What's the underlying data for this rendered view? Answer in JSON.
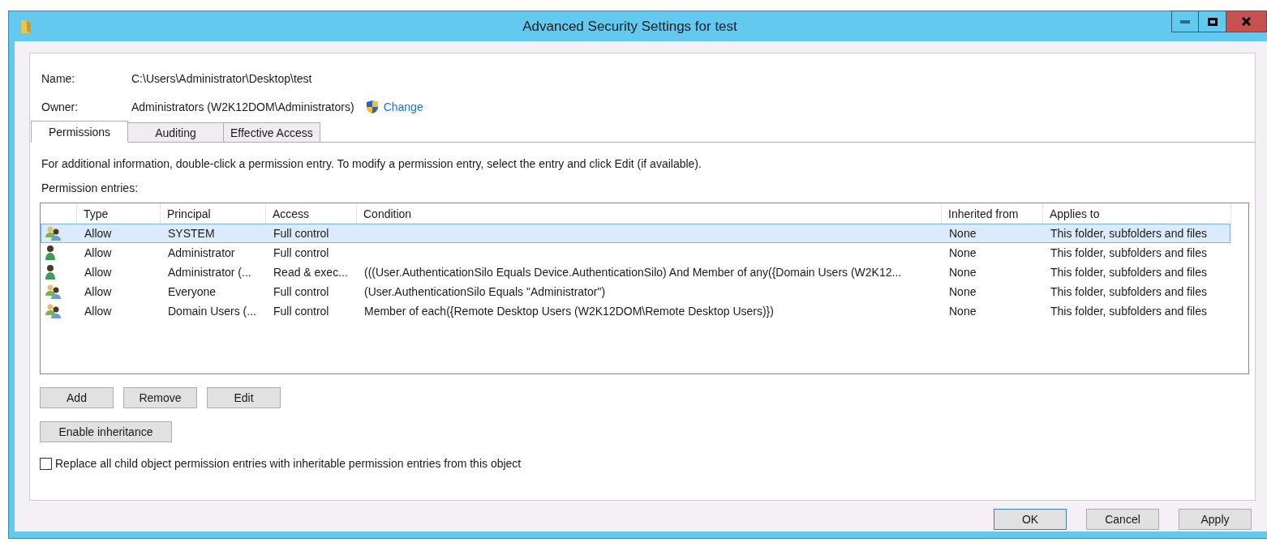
{
  "window": {
    "title": "Advanced Security Settings for test"
  },
  "name": {
    "label": "Name:",
    "value": "C:\\Users\\Administrator\\Desktop\\test"
  },
  "owner": {
    "label": "Owner:",
    "value": "Administrators (W2K12DOM\\Administrators)",
    "link": "Change"
  },
  "tabs": [
    {
      "label": "Permissions",
      "selected": true
    },
    {
      "label": "Auditing",
      "selected": false
    },
    {
      "label": "Effective Access",
      "selected": false
    }
  ],
  "info": "For additional information, double-click a permission entry. To modify a permission entry, select the entry and click Edit (if available).",
  "entries_label": "Permission entries:",
  "table": {
    "columns": [
      "Type",
      "Principal",
      "Access",
      "Condition",
      "Inherited from",
      "Applies to"
    ],
    "rows": [
      {
        "kind": "group",
        "selected": true,
        "cells": [
          "Allow",
          "SYSTEM",
          "Full control",
          "",
          "None",
          "This folder, subfolders and files"
        ]
      },
      {
        "kind": "user",
        "selected": false,
        "cells": [
          "Allow",
          "Administrator",
          "Full control",
          "",
          "None",
          "This folder, subfolders and files"
        ]
      },
      {
        "kind": "user",
        "selected": false,
        "cells": [
          "Allow",
          "Administrator (...",
          "Read & exec...",
          "(((User.AuthenticationSilo Equals Device.AuthenticationSilo) And Member of any({Domain Users (W2K12...",
          "None",
          "This folder, subfolders and files"
        ]
      },
      {
        "kind": "group",
        "selected": false,
        "cells": [
          "Allow",
          "Everyone",
          "Full control",
          "(User.AuthenticationSilo Equals \"Administrator\")",
          "None",
          "This folder, subfolders and files"
        ]
      },
      {
        "kind": "group",
        "selected": false,
        "cells": [
          "Allow",
          "Domain Users (...",
          "Full control",
          "Member of each({Remote Desktop Users (W2K12DOM\\Remote Desktop Users)})",
          "None",
          "This folder, subfolders and files"
        ]
      }
    ]
  },
  "entry_buttons": [
    "Add",
    "Remove",
    "Edit"
  ],
  "inheritance_button": "Enable inheritance",
  "replace_checkbox": {
    "label": "Replace all child object permission entries with inheritable permission entries from this object",
    "checked": false
  },
  "dialog_buttons": [
    {
      "label": "OK",
      "default": true
    },
    {
      "label": "Cancel",
      "default": false
    },
    {
      "label": "Apply",
      "default": false
    }
  ]
}
